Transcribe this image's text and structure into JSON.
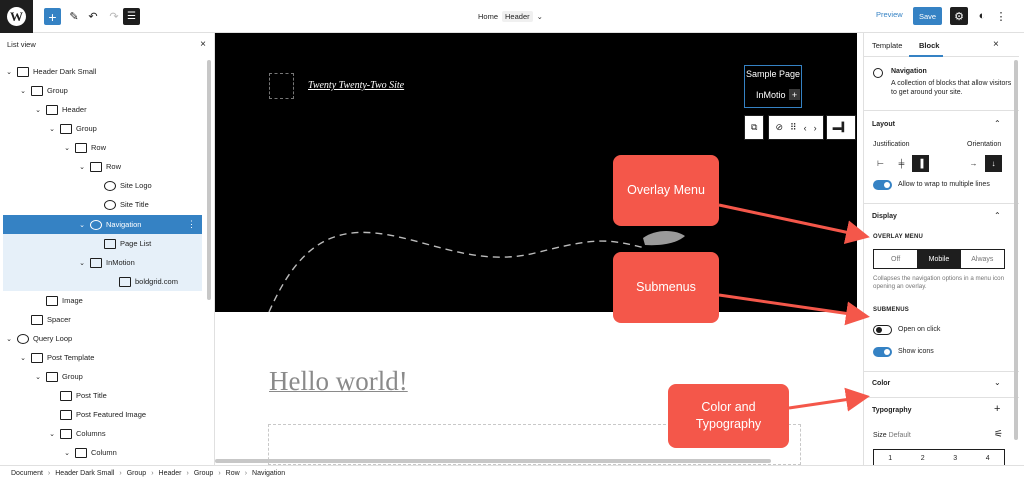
{
  "topbar": {
    "logo_letter": "W",
    "add_icon": "+",
    "pen_icon": "✎",
    "undo_icon": "↶",
    "redo_icon": "↷",
    "list_icon": "☰",
    "doc_name": "Home",
    "doc_tag": "Header",
    "doc_chevron": "⌄",
    "preview_label": "Preview",
    "save_label": "Save",
    "settings_icon": "⚙",
    "styles_icon": "◐",
    "more_icon": "⋮"
  },
  "listview": {
    "title": "List view",
    "close_icon": "×",
    "items": [
      {
        "label": "Header Dark Small",
        "chevron": "⌄"
      },
      {
        "label": "Group",
        "chevron": "⌄"
      },
      {
        "label": "Header",
        "chevron": "⌄"
      },
      {
        "label": "Group",
        "chevron": "⌄"
      },
      {
        "label": "Row",
        "chevron": "⌄"
      },
      {
        "label": "Row",
        "chevron": "⌄"
      },
      {
        "label": "Site Logo",
        "chevron": ""
      },
      {
        "label": "Site Title",
        "chevron": ""
      },
      {
        "label": "Navigation",
        "chevron": "⌄"
      },
      {
        "label": "Page List",
        "chevron": ""
      },
      {
        "label": "InMotion",
        "chevron": "⌄"
      },
      {
        "label": "boldgrid.com",
        "chevron": ""
      },
      {
        "label": "Image",
        "chevron": ""
      },
      {
        "label": "Spacer",
        "chevron": ""
      },
      {
        "label": "Query Loop",
        "chevron": "⌄"
      },
      {
        "label": "Post Template",
        "chevron": "⌄"
      },
      {
        "label": "Group",
        "chevron": "⌄"
      },
      {
        "label": "Post Title",
        "chevron": ""
      },
      {
        "label": "Post Featured Image",
        "chevron": ""
      },
      {
        "label": "Columns",
        "chevron": "⌄"
      },
      {
        "label": "Column",
        "chevron": "⌄"
      }
    ],
    "kebab_icon": "⋮"
  },
  "canvas": {
    "site_title": "Twenty Twenty-Two Site",
    "nav_item_1": "Sample Page",
    "nav_item_2": "InMotio",
    "nav_plus": "+",
    "toolbar_parent_icon": "⧉",
    "toolbar_nav_icon": "⊘",
    "toolbar_drag_icon": "⠿",
    "toolbar_prev_icon": "‹",
    "toolbar_next_icon": "›",
    "toolbar_justify_icon": "▬▍",
    "post_title": "Hello world!"
  },
  "callouts": {
    "overlay_menu": "Overlay Menu",
    "submenus": "Submenus",
    "color_typography": "Color and Typography",
    "color": "#f4574a"
  },
  "settings": {
    "tab_template": "Template",
    "tab_block": "Block",
    "close_icon": "×",
    "block_name": "Navigation",
    "block_description": "A collection of blocks that allow visitors to get around your site.",
    "layout_title": "Layout",
    "justification_label": "Justification",
    "orientation_label": "Orientation",
    "wrap_label": "Allow to wrap to multiple lines",
    "display_title": "Display",
    "overlay_menu_label": "OVERLAY MENU",
    "overlay_options": [
      "Off",
      "Mobile",
      "Always"
    ],
    "overlay_selected": "Mobile",
    "overlay_help": "Collapses the navigation options in a menu icon opening an overlay.",
    "submenus_label": "SUBMENUS",
    "open_on_click_label": "Open on click",
    "show_icons_label": "Show icons",
    "color_title": "Color",
    "typography_title": "Typography",
    "size_label": "Size",
    "size_value": "Default",
    "size_options": [
      "1",
      "2",
      "3",
      "4"
    ],
    "chevron_up": "⌃",
    "chevron_down": "⌄",
    "plus_icon": "+",
    "sliders_icon": "⚟",
    "accent": "#3582c4"
  },
  "footer": {
    "crumbs": [
      "Document",
      "Header Dark Small",
      "Group",
      "Header",
      "Group",
      "Row",
      "Navigation"
    ],
    "separator": "›"
  }
}
